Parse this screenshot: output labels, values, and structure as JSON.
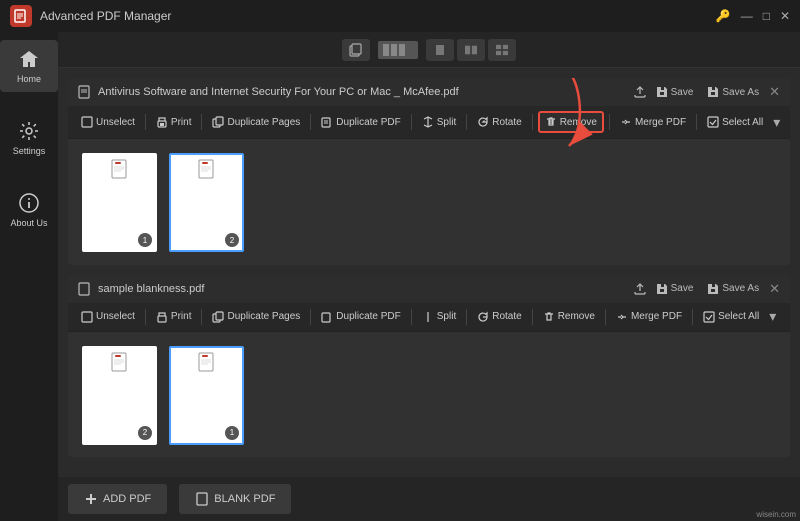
{
  "app": {
    "title": "Advanced PDF Manager",
    "logo_label": "PDF"
  },
  "titlebar": {
    "controls": [
      "🔑",
      "—",
      "□",
      "✕"
    ]
  },
  "toolbar": {
    "icon_label": "copy-icon",
    "tab_labels": [
      "single",
      "double",
      "quad"
    ]
  },
  "sidebar": {
    "items": [
      {
        "label": "Home",
        "icon": "home-icon",
        "active": true
      },
      {
        "label": "Settings",
        "icon": "settings-icon",
        "active": false
      },
      {
        "label": "About Us",
        "icon": "info-icon",
        "active": false
      }
    ]
  },
  "pdf_sections": [
    {
      "id": "pdf1",
      "title": "Antivirus Software and Internet Security For Your PC or Mac _ McAfee.pdf",
      "has_dot": true,
      "header_actions": [
        "Save",
        "Save As"
      ],
      "toolbar_buttons": [
        "Unselect",
        "Print",
        "Duplicate Pages",
        "Duplicate PDF",
        "Split",
        "Rotate",
        "Remove",
        "Merge PDF",
        "Select All"
      ],
      "pages": [
        {
          "number": "1",
          "selected": false
        },
        {
          "number": "2",
          "selected": true
        }
      ]
    },
    {
      "id": "pdf2",
      "title": "sample blankness.pdf",
      "has_dot": true,
      "header_actions": [
        "Save",
        "Save As"
      ],
      "toolbar_buttons": [
        "Unselect",
        "Print",
        "Duplicate Pages",
        "Duplicate PDF",
        "Split",
        "Rotate",
        "Remove",
        "Merge PDF",
        "Select All"
      ],
      "pages": [
        {
          "number": "2",
          "selected": false
        },
        {
          "number": "1",
          "selected": true
        }
      ]
    }
  ],
  "bottom_buttons": [
    "ADD PDF",
    "BLANK PDF"
  ],
  "watermark": "wisein.com"
}
